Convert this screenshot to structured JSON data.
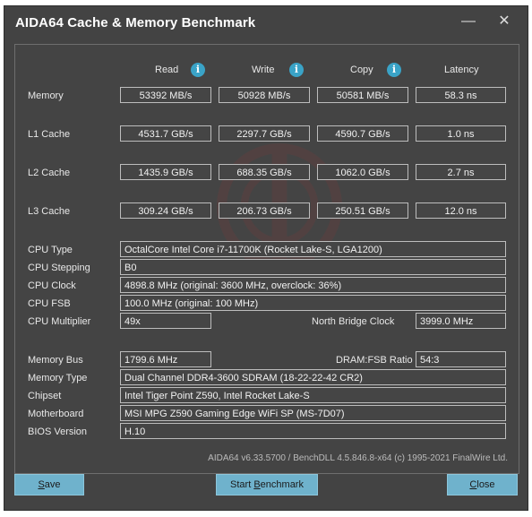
{
  "window": {
    "title": "AIDA64 Cache & Memory Benchmark"
  },
  "titlebar_icons": [
    "minimize-icon",
    "close-icon"
  ],
  "columns": {
    "read": "Read",
    "write": "Write",
    "copy": "Copy",
    "latency": "Latency"
  },
  "bench_rows": [
    {
      "label": "Memory",
      "read": "53392 MB/s",
      "write": "50928 MB/s",
      "copy": "50581 MB/s",
      "latency": "58.3 ns"
    },
    {
      "label": "L1 Cache",
      "read": "4531.7 GB/s",
      "write": "2297.7 GB/s",
      "copy": "4590.7 GB/s",
      "latency": "1.0 ns"
    },
    {
      "label": "L2 Cache",
      "read": "1435.9 GB/s",
      "write": "688.35 GB/s",
      "copy": "1062.0 GB/s",
      "latency": "2.7 ns"
    },
    {
      "label": "L3 Cache",
      "read": "309.24 GB/s",
      "write": "206.73 GB/s",
      "copy": "250.51 GB/s",
      "latency": "12.0 ns"
    }
  ],
  "cpu": {
    "type_label": "CPU Type",
    "type": "OctalCore Intel Core i7-11700K  (Rocket Lake-S, LGA1200)",
    "stepping_label": "CPU Stepping",
    "stepping": "B0",
    "clock_label": "CPU Clock",
    "clock": "4898.8 MHz  (original: 3600 MHz, overclock: 36%)",
    "fsb_label": "CPU FSB",
    "fsb": "100.0 MHz  (original: 100 MHz)",
    "multiplier_label": "CPU Multiplier",
    "multiplier": "49x",
    "nb_clock_label": "North Bridge Clock",
    "nb_clock": "3999.0 MHz"
  },
  "memory": {
    "bus_label": "Memory Bus",
    "bus": "1799.6 MHz",
    "ratio_label": "DRAM:FSB Ratio",
    "ratio": "54:3",
    "type_label": "Memory Type",
    "type": "Dual Channel DDR4-3600 SDRAM  (18-22-22-42 CR2)",
    "chipset_label": "Chipset",
    "chipset": "Intel Tiger Point Z590, Intel Rocket Lake-S",
    "motherboard_label": "Motherboard",
    "motherboard": "MSI MPG Z590 Gaming Edge WiFi SP (MS-7D07)",
    "bios_label": "BIOS Version",
    "bios": "H.10"
  },
  "footer": "AIDA64 v6.33.5700 / BenchDLL 4.5.846.8-x64  (c) 1995-2021 FinalWire Ltd.",
  "buttons": {
    "save_u": "S",
    "save_rest": "ave",
    "start_pre": "Start ",
    "start_u": "B",
    "start_rest": "enchmark",
    "close_u": "C",
    "close_rest": "lose"
  }
}
